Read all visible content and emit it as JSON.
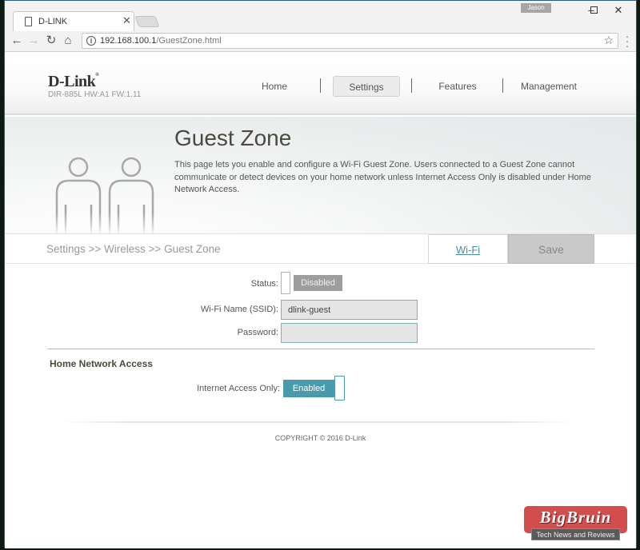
{
  "browser": {
    "tab_title": "D-LINK",
    "profile_name": "Jason",
    "url_host": "192.168.100.1",
    "url_path": "/GuestZone.html",
    "icons": {
      "page": "page-icon",
      "close": "✕",
      "back": "←",
      "forward": "→",
      "reload": "↻",
      "home": "⌂",
      "info": "i",
      "star": "☆",
      "menu": "⋮",
      "minimize": "–",
      "maximize": "☐",
      "window_close": "✕"
    }
  },
  "header": {
    "logo": "D-Link",
    "logo_mark": "®",
    "model": "DIR-885L HW:A1 FW:1.11",
    "nav": [
      {
        "label": "Home",
        "active": false
      },
      {
        "label": "Settings",
        "active": true
      },
      {
        "label": "Features",
        "active": false
      },
      {
        "label": "Management",
        "active": false
      }
    ]
  },
  "banner": {
    "title": "Guest Zone",
    "description": "This page lets you enable and configure a Wi-Fi Guest Zone. Users connected to a Guest Zone cannot communicate or detect devices on your home network unless Internet Access Only is disabled under Home Network Access."
  },
  "crumbbar": {
    "breadcrumb": "Settings >> Wireless >> Guest Zone",
    "wifi_link": "Wi-Fi",
    "save_label": "Save"
  },
  "form": {
    "status_label": "Status:",
    "status_value": "Disabled",
    "ssid_label": "Wi-Fi Name (SSID):",
    "ssid_value": "dlink-guest",
    "password_label": "Password:",
    "password_value": ""
  },
  "home_network": {
    "section_title": "Home Network Access",
    "internet_only_label": "Internet Access Only:",
    "internet_only_value": "Enabled"
  },
  "footer": {
    "copyright": "COPYRIGHT © 2016 D-Link"
  },
  "watermark": {
    "brand": "BigBruin",
    "tagline": "Tech News and Reviews"
  },
  "colors": {
    "accent": "#4a9aad",
    "disabled_toggle": "#9e9e9e",
    "save_button": "#c9c9c9",
    "field_border": "#7fb0b8"
  }
}
